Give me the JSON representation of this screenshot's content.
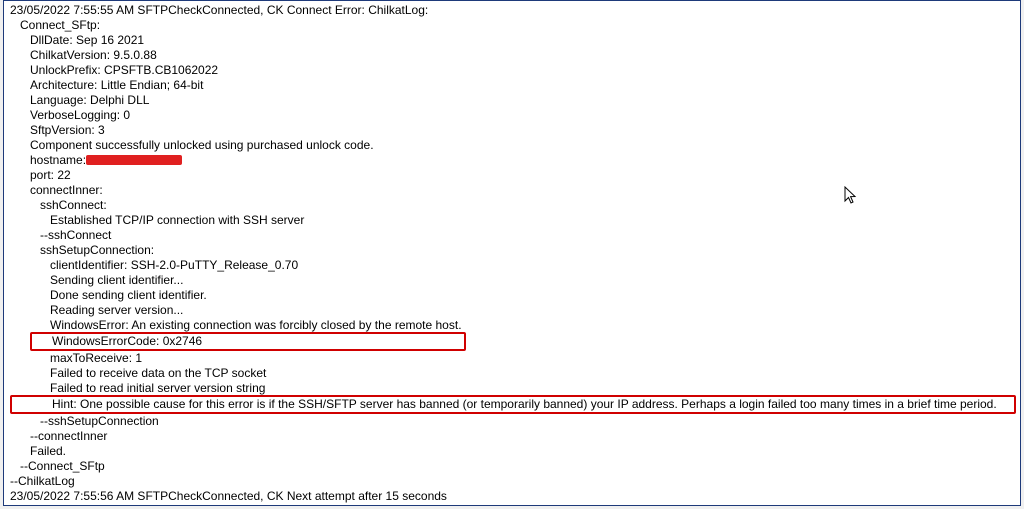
{
  "log_lines": {
    "l00_cut": "…………… … … … … … … … … … … … …",
    "l01": "23/05/2022 7:55:55 AM SFTPCheckConnected, CK Connect Error: ChilkatLog:",
    "l02": "Connect_SFtp:",
    "l03": "DllDate: Sep 16 2021",
    "l04": "ChilkatVersion: 9.5.0.88",
    "l05": "UnlockPrefix: CPSFTB.CB1062022",
    "l06": "Architecture: Little Endian; 64-bit",
    "l07": "Language: Delphi DLL",
    "l08": "VerboseLogging: 0",
    "l09": "SftpVersion: 3",
    "l10": "Component successfully unlocked using purchased unlock code.",
    "l11_label": "hostname:",
    "l12": "port: 22",
    "l13": "connectInner:",
    "l14": "sshConnect:",
    "l15": "Established TCP/IP connection with SSH server",
    "l16": "--sshConnect",
    "l17": "sshSetupConnection:",
    "l18": "clientIdentifier: SSH-2.0-PuTTY_Release_0.70",
    "l19": "Sending client identifier...",
    "l20": "Done sending client identifier.",
    "l21": "Reading server version...",
    "l22": "WindowsError: An existing connection was forcibly closed by the remote host.",
    "l23": "WindowsErrorCode: 0x2746",
    "l24": "maxToReceive: 1",
    "l25": "Failed to receive data on the TCP socket",
    "l26": "Failed to read initial server version string",
    "l27": "Hint: One possible cause for this error is if the SSH/SFTP server has banned (or temporarily banned) your IP address.  Perhaps a login failed too many times in a brief time period.",
    "l28": "--sshSetupConnection",
    "l29": "--connectInner",
    "l30": "Failed.",
    "l31": "--Connect_SFtp",
    "l32": "--ChilkatLog",
    "l33": "23/05/2022 7:55:56 AM SFTPCheckConnected, CK Next attempt after 15 seconds"
  },
  "annotations": {
    "hostname_redacted": true,
    "highlighted_error_code": "0x2746",
    "highlighted_hint_present": true
  }
}
